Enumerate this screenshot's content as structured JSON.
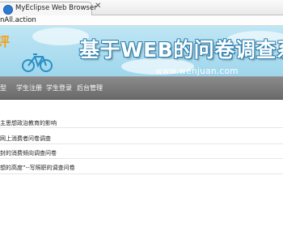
{
  "window": {
    "tab_title": "MyEclipse Web Browser",
    "close_glyph": "✕"
  },
  "address_bar": {
    "url": "nAll.action"
  },
  "banner": {
    "decor_char": "评",
    "title": "基于WEB的问卷调查系",
    "url": "www.wenjuan.com"
  },
  "nav": {
    "items": [
      "型",
      "学生注册",
      "学生登录",
      "后台管理"
    ]
  },
  "list": {
    "items": [
      "主思想政治教育的影响",
      "网上消费者问卷调查",
      "封的消费倾向调查问卷",
      "想的高度”--写照职的调查问卷"
    ]
  },
  "colors": {
    "banner_bg": "#a6d9ee",
    "nav_bg": "#7a7a7a",
    "title_stroke": "#2a7fb0"
  }
}
